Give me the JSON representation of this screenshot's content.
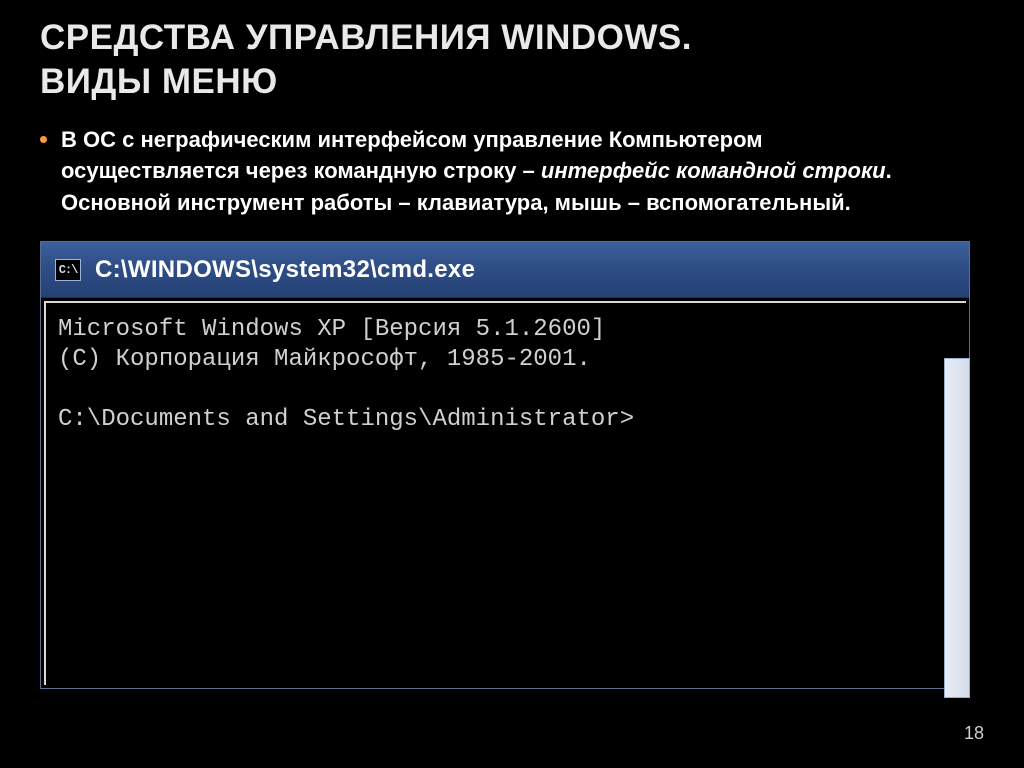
{
  "heading": {
    "line1": "СРЕДСТВА УПРАВЛЕНИЯ WINDOWS.",
    "line2": " ВИДЫ МЕНЮ"
  },
  "bullet": {
    "part1": "В ОС с неграфическим интерфейсом управление Компьютером осуществляется через командную строку – ",
    "italic": "интерфейс командной строки",
    "part2": ". Основной инструмент работы – клавиатура, мышь – вспомогательный."
  },
  "cmd": {
    "icon": "C:\\",
    "title": "C:\\WINDOWS\\system32\\cmd.exe",
    "line1": "Microsoft Windows XP [Версия 5.1.2600]",
    "line2": "(C) Корпорация Майкрософт, 1985-2001.",
    "blank": "",
    "prompt": "C:\\Documents and Settings\\Administrator>"
  },
  "page_number": "18"
}
